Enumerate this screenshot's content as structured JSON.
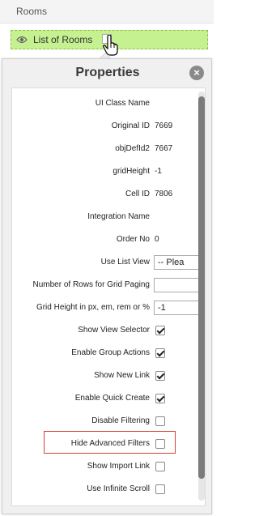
{
  "header": {
    "title": "Rooms"
  },
  "list_row": {
    "label": "List of Rooms"
  },
  "panel": {
    "title": "Properties",
    "close_symbol": "×",
    "fields": [
      {
        "label": "UI Class Name",
        "type": "text",
        "value": ""
      },
      {
        "label": "Original ID",
        "type": "text",
        "value": "7669"
      },
      {
        "label": "objDefId2",
        "type": "text",
        "value": "7667"
      },
      {
        "label": "gridHeight",
        "type": "text",
        "value": "-1"
      },
      {
        "label": "Cell ID",
        "type": "text",
        "value": "7806"
      },
      {
        "label": "Integration Name",
        "type": "text",
        "value": ""
      },
      {
        "label": "Order No",
        "type": "text",
        "value": "0"
      },
      {
        "label": "Use List View",
        "type": "select",
        "value": "-- Plea"
      },
      {
        "label": "Number of Rows for Grid Paging",
        "type": "input",
        "value": ""
      },
      {
        "label": "Grid Height in px, em, rem or %",
        "type": "input",
        "value": "-1"
      },
      {
        "label": "Show View Selector",
        "type": "checkbox",
        "checked": true
      },
      {
        "label": "Enable Group Actions",
        "type": "checkbox",
        "checked": true
      },
      {
        "label": "Show New Link",
        "type": "checkbox",
        "checked": true
      },
      {
        "label": "Enable Quick Create",
        "type": "checkbox",
        "checked": true
      },
      {
        "label": "Disable Filtering",
        "type": "checkbox",
        "checked": false
      },
      {
        "label": "Hide Advanced Filters",
        "type": "checkbox",
        "checked": false
      },
      {
        "label": "Show Import Link",
        "type": "checkbox",
        "checked": false
      },
      {
        "label": "Use Infinite Scroll",
        "type": "checkbox",
        "checked": false
      }
    ]
  },
  "colors": {
    "list_row_bg": "#c6f191",
    "highlight": "#d9413b"
  }
}
